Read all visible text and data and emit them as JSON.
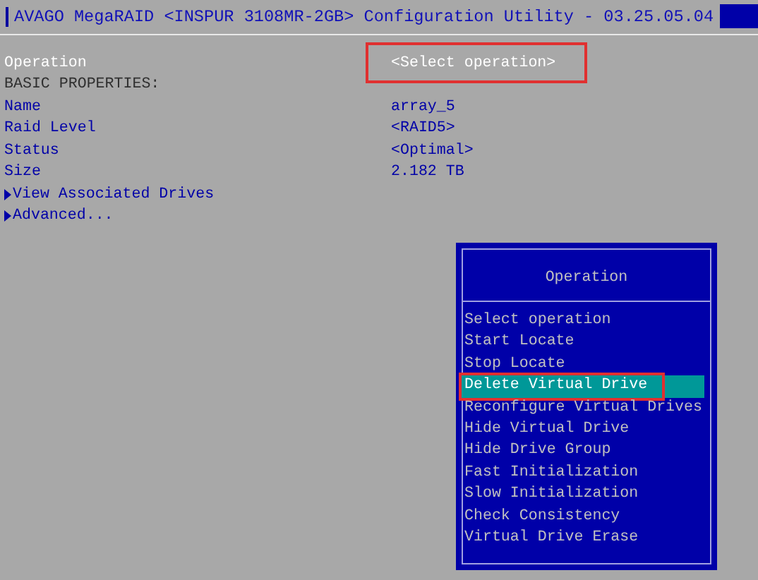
{
  "window": {
    "title": "AVAGO MegaRAID <INSPUR 3108MR-2GB> Configuration Utility - 03.25.05.04"
  },
  "properties": [
    {
      "kind": "field",
      "label": "Operation",
      "value": "<Select operation>",
      "focused": true,
      "highlighted": true
    },
    {
      "kind": "heading",
      "label": "BASIC PROPERTIES:"
    },
    {
      "kind": "field",
      "label": "Name",
      "value": "array_5",
      "focused": false,
      "highlighted": false
    },
    {
      "kind": "field",
      "label": "Raid Level",
      "value": "<RAID5>",
      "focused": false,
      "highlighted": false
    },
    {
      "kind": "field",
      "label": "Status",
      "value": "<Optimal>",
      "focused": false,
      "highlighted": false
    },
    {
      "kind": "field",
      "label": "Size",
      "value": "2.182 TB",
      "focused": false,
      "highlighted": false
    },
    {
      "kind": "link",
      "label": "View Associated Drives"
    },
    {
      "kind": "link",
      "label": "Advanced..."
    }
  ],
  "popup": {
    "title": "Operation",
    "items": [
      {
        "label": "Select operation",
        "selected": false,
        "highlighted": false
      },
      {
        "label": "Start Locate",
        "selected": false,
        "highlighted": false
      },
      {
        "label": "Stop Locate",
        "selected": false,
        "highlighted": false
      },
      {
        "label": "Delete Virtual Drive",
        "selected": true,
        "highlighted": true
      },
      {
        "label": "Reconfigure Virtual Drives",
        "selected": false,
        "highlighted": false
      },
      {
        "label": "Hide Virtual Drive",
        "selected": false,
        "highlighted": false
      },
      {
        "label": "Hide Drive Group",
        "selected": false,
        "highlighted": false
      },
      {
        "label": "Fast Initialization",
        "selected": false,
        "highlighted": false
      },
      {
        "label": "Slow Initialization",
        "selected": false,
        "highlighted": false
      },
      {
        "label": "Check Consistency",
        "selected": false,
        "highlighted": false
      },
      {
        "label": "Virtual Drive Erase",
        "selected": false,
        "highlighted": false
      }
    ]
  }
}
